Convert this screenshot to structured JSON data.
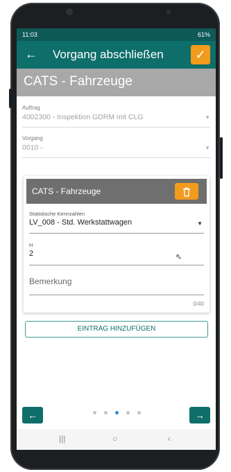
{
  "status_bar": {
    "time": "11:03",
    "battery": "61%"
  },
  "app_bar": {
    "title": "Vorgang abschließen"
  },
  "banner": {
    "title": "CATS - Fahrzeuge"
  },
  "auftrag": {
    "label": "Auftrag",
    "value": "4002300 - Inspektion GDRM mit CLG"
  },
  "vorgang": {
    "label": "Vorgang",
    "value": "0010 -"
  },
  "card": {
    "title": "CATS - Fahrzeuge",
    "stat_label": "Statistische Kennzahlen",
    "stat_value": "LV_008 - Std. Werkstattwagen",
    "h_label": "H",
    "h_value": "2",
    "bemerkung_placeholder": "Bemerkung",
    "char_counter": "0/40"
  },
  "add_entry_label": "EINTRAG HINZUFÜGEN",
  "pager": {
    "count": 5,
    "active_index": 2
  },
  "colors": {
    "primary": "#0e6e6a",
    "accent": "#f29b1d",
    "banner": "#a8a8a8"
  }
}
